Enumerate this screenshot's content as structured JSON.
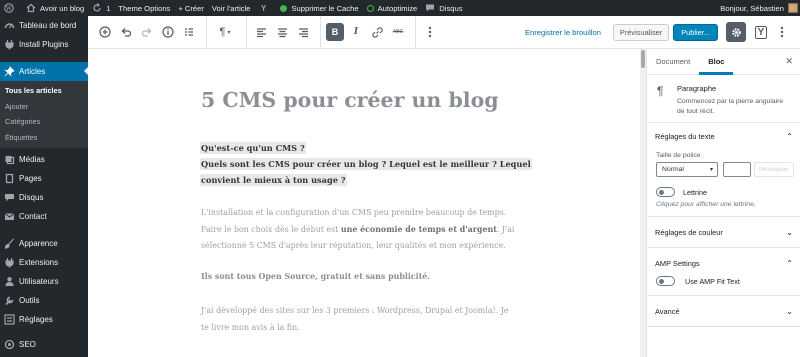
{
  "adminbar": {
    "wp_icon": "wordpress-logo-icon",
    "home_label": "Avoir un blog",
    "updates_count": "1",
    "theme_options": "Theme Options",
    "new_label": "+ Créer",
    "view_post": "Voir l'article",
    "cache_label": "Supprimer le Cache",
    "autoptimize_label": "Autoptimize",
    "disqus_label": "Disqus",
    "greeting": "Bonjour, Sébastien",
    "cache_dot_color": "#46b450"
  },
  "menu": {
    "items": [
      {
        "icon": "dashboard-icon",
        "label": "Tableau de bord"
      },
      {
        "icon": "plugin-icon",
        "label": "Install Plugins"
      },
      {
        "icon": "pin-icon",
        "label": "Articles"
      },
      {
        "icon": "media-icon",
        "label": "Médias"
      },
      {
        "icon": "page-icon",
        "label": "Pages"
      },
      {
        "icon": "comments-icon",
        "label": "Disqus"
      },
      {
        "icon": "mail-icon",
        "label": "Contact"
      },
      {
        "icon": "brush-icon",
        "label": "Apparence"
      },
      {
        "icon": "plugin-icon",
        "label": "Extensions"
      },
      {
        "icon": "users-icon",
        "label": "Utilisateurs"
      },
      {
        "icon": "tools-icon",
        "label": "Outils"
      },
      {
        "icon": "settings-icon",
        "label": "Réglages"
      },
      {
        "icon": "seo-icon",
        "label": "SEO"
      }
    ],
    "submenu": [
      "Tous les articles",
      "Ajouter",
      "Catégories",
      "Étiquettes"
    ]
  },
  "header": {
    "save_draft": "Enregistrer le brouillon",
    "preview": "Prévisualiser",
    "publish": "Publier...",
    "paragraph_symbol": "¶",
    "bold": "B",
    "italic": "I",
    "strike": "ABC"
  },
  "post": {
    "title": "5 CMS pour créer un blog",
    "heading1": "Qu'est-ce qu'un CMS ?",
    "heading2": "Quels sont les CMS pour créer un blog ? Lequel est le meilleur ? Lequel",
    "heading3": "convient le mieux à ton usage ?",
    "p1_line1": "L'installation et la configuration d'un CMS peu prendre beaucoup de temps.",
    "p1_line2a": "Faire le bon choix dès le début est ",
    "p1_line2b": "une économie de temps et d'argent",
    "p1_line2c": ". J'ai",
    "p1_line3": "sélectionné 5 CMS d'après leur réputation, leur qualités et mon expérience.",
    "p2": "Ils sont tous Open Source, gratuit et sans publicité.",
    "p3_line1": "J'ai développé des sites sur les 3 premiers : Wordpress, Drupal et Joomla!. Je",
    "p3_line2": "te livre mon avis à la fin."
  },
  "sidebar": {
    "tab_document": "Document",
    "tab_bloc": "Bloc",
    "block_name": "Paragraphe",
    "block_desc": "Commencez par la pierre angulaire de tout récit.",
    "text_settings": "Réglages du texte",
    "font_size_label": "Taille de police",
    "font_size_value": "Normal",
    "reset_label": "Réinitialiser",
    "dropcap_label": "Lettrine",
    "dropcap_help": "Cliquez pour afficher une lettrine.",
    "color_settings": "Réglages de couleur",
    "amp_settings": "AMP Settings",
    "amp_fit_text": "Use AMP Fit Text",
    "advanced": "Avancé"
  }
}
